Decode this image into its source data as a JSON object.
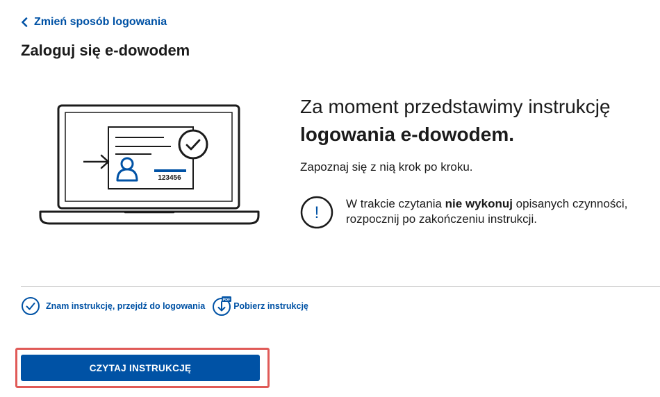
{
  "header": {
    "back_label": "Zmień sposób logowania",
    "title": "Zaloguj się e-dowodem"
  },
  "illustration": {
    "card_number": "123456"
  },
  "intro": {
    "line1": "Za moment przedstawimy instrukcję",
    "line2": "logowania e-dowodem.",
    "subtitle": "Zapoznaj się z nią krok po kroku."
  },
  "warning": {
    "icon_glyph": "!",
    "text_before": "W trakcie czytania ",
    "text_bold": "nie wykonuj",
    "text_after": " opisanych czynności, rozpocznij po zakończeniu instrukcji."
  },
  "links": {
    "know_instruction": "Znam instrukcję, przejdź do logowania",
    "download_badge": "PDF",
    "download_instruction": "Pobierz instrukcję"
  },
  "cta": {
    "label": "CZYTAJ INSTRUKCJĘ"
  },
  "colors": {
    "link_blue": "#0052a5",
    "primary_button": "#0052a5",
    "highlight_frame": "#e05a57",
    "divider": "#c8c8c8"
  },
  "icons": [
    "chevron-left-icon",
    "laptop-illustration",
    "exclamation-circle-icon",
    "check-circle-icon",
    "download-pdf-icon"
  ]
}
